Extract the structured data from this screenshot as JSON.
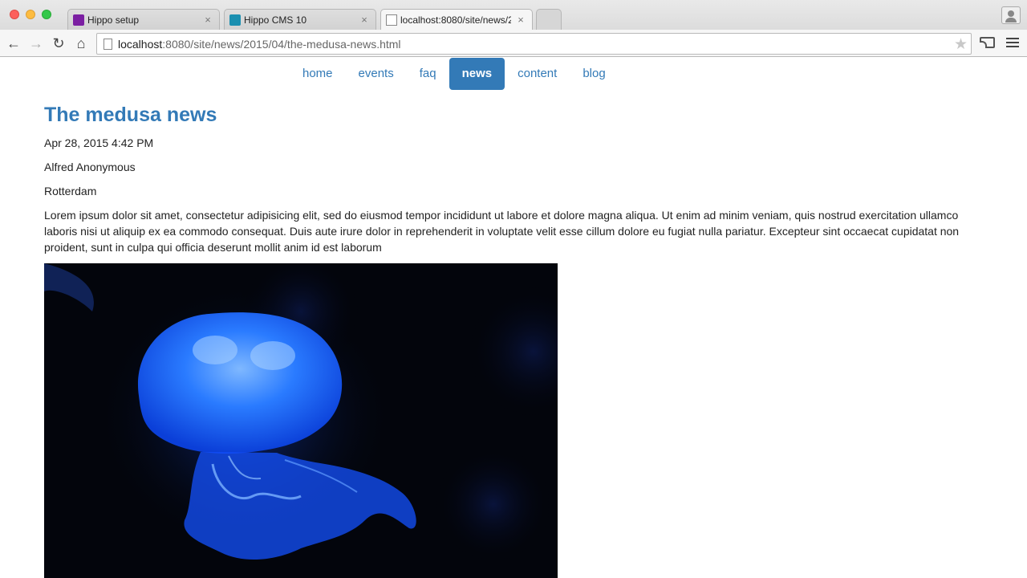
{
  "browser": {
    "tabs": [
      {
        "title": "Hippo setup",
        "favicon": "hippo-icon"
      },
      {
        "title": "Hippo CMS 10",
        "favicon": "cms-icon"
      },
      {
        "title": "localhost:8080/site/news/2",
        "favicon": "page-icon"
      }
    ],
    "close_glyph": "×",
    "url_host": "localhost",
    "url_rest": ":8080/site/news/2015/04/the-medusa-news.html"
  },
  "nav": {
    "items": [
      "home",
      "events",
      "faq",
      "news",
      "content",
      "blog"
    ],
    "active": "news"
  },
  "article": {
    "title": "The medusa news",
    "date": "Apr 28, 2015 4:42 PM",
    "author": "Alfred Anonymous",
    "location": "Rotterdam",
    "body": "Lorem ipsum dolor sit amet, consectetur adipisicing elit, sed do eiusmod tempor incididunt ut labore et dolore magna aliqua. Ut enim ad minim veniam, quis nostrud exercitation ullamco laboris nisi ut aliquip ex ea commodo consequat. Duis aute irure dolor in reprehenderit in voluptate velit esse cillum dolore eu fugiat nulla pariatur. Excepteur sint occaecat cupidatat non proident, sunt in culpa qui officia deserunt mollit anim id est laborum",
    "image_subject": "blue jellyfish on black background"
  },
  "colors": {
    "link": "#337ab7",
    "nav_active_bg": "#337ab7",
    "jellyfish": "#1a6cff"
  }
}
